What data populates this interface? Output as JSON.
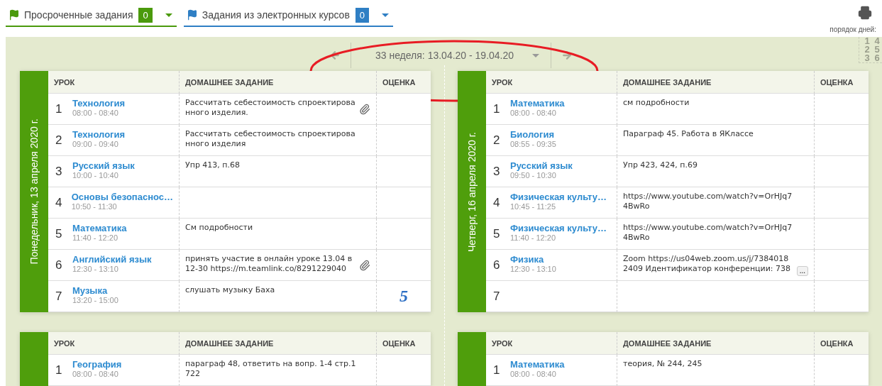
{
  "filters": [
    {
      "label": "Просроченные задания",
      "count": "0",
      "color": "#4b9a0c"
    },
    {
      "label": "Задания из электронных курсов",
      "count": "0",
      "color": "#2f7fc4"
    }
  ],
  "day_order": {
    "label": "порядок дней:",
    "numbers": [
      "1",
      "4",
      "2",
      "5",
      "3",
      "6"
    ]
  },
  "week": {
    "label": "33 неделя: 13.04.20 - 19.04.20"
  },
  "days": [
    {
      "date": "Понедельник, 13 апреля 2020 г.",
      "columns": [
        "УРОК",
        "ДОМАШНЕЕ ЗАДАНИЕ",
        "ОЦЕНКА"
      ],
      "lessons": [
        {
          "num": "1",
          "subject": "Технология",
          "time": "08:00 - 08:40",
          "homework": "Рассчитать себестоимость спроектирова нного изделия.",
          "attachment": true
        },
        {
          "num": "2",
          "subject": "Технология",
          "time": "09:00 - 09:40",
          "homework": "Рассчитать себестоимость спроектирова нного изделия",
          "attachment": false
        },
        {
          "num": "3",
          "subject": "Русский язык",
          "time": "10:00 - 10:40",
          "homework": "Упр 413, п.68",
          "attachment": false
        },
        {
          "num": "4",
          "subject": "Основы безопаснос…",
          "time": "10:50 - 11:30",
          "attachment": false
        },
        {
          "num": "5",
          "subject": "Математика",
          "time": "11:40 - 12:20",
          "homework": "См подробности",
          "attachment": false
        },
        {
          "num": "6",
          "subject": "Английский язык",
          "time": "12:30 - 13:10",
          "homework": "принять участие в онлайн уроке 13.04 в 12-30 https://m.teamlink.co/8291229040",
          "attachment": true
        },
        {
          "num": "7",
          "subject": "Музыка",
          "time": "13:20 - 15:00",
          "homework": "слушать музыку Баха",
          "attachment": false,
          "grade": "5"
        }
      ]
    },
    {
      "date": "Четверг, 16 апреля 2020 г.",
      "columns": [
        "УРОК",
        "ДОМАШНЕЕ ЗАДАНИЕ",
        "ОЦЕНКА"
      ],
      "lessons": [
        {
          "num": "1",
          "subject": "Математика",
          "time": "08:00 - 08:40",
          "homework": "см подробности",
          "attachment": false
        },
        {
          "num": "2",
          "subject": "Биология",
          "time": "08:55 - 09:35",
          "homework": "Параграф 45. Работа в ЯКлассе",
          "attachment": false
        },
        {
          "num": "3",
          "subject": "Русский язык",
          "time": "09:50 - 10:30",
          "homework": "Упр 423, 424, п.69",
          "attachment": false
        },
        {
          "num": "4",
          "subject": "Физическая культу…",
          "time": "10:45 - 11:25",
          "homework": "https://www.youtube.com/watch?v=OrHJq7 4BwRo",
          "attachment": false
        },
        {
          "num": "5",
          "subject": "Физическая культу…",
          "time": "11:40 - 12:20",
          "homework": "https://www.youtube.com/watch?v=OrHJq7 4BwRo",
          "attachment": false
        },
        {
          "num": "6",
          "subject": "Физика",
          "time": "12:30 - 13:10",
          "homework": "Zoom https://us04web.zoom.us/j/7384018 2409 Идентификатор конференции: 738",
          "attachment": false,
          "more": "..."
        },
        {
          "num": "7",
          "attachment": false
        }
      ]
    },
    {
      "columns": [
        "УРОК",
        "ДОМАШНЕЕ ЗАДАНИЕ",
        "ОЦЕНКА"
      ],
      "lessons": [
        {
          "num": "1",
          "subject": "География",
          "time": "08:00 - 08:40",
          "homework": "параграф 48, ответить на вопр. 1-4 стр.1 722",
          "attachment": false
        }
      ]
    },
    {
      "columns": [
        "УРОК",
        "ДОМАШНЕЕ ЗАДАНИЕ",
        "ОЦЕНКА"
      ],
      "lessons": [
        {
          "num": "1",
          "subject": "Математика",
          "time": "08:00 - 08:40",
          "homework": "теория, № 244, 245",
          "attachment": false
        }
      ]
    }
  ]
}
